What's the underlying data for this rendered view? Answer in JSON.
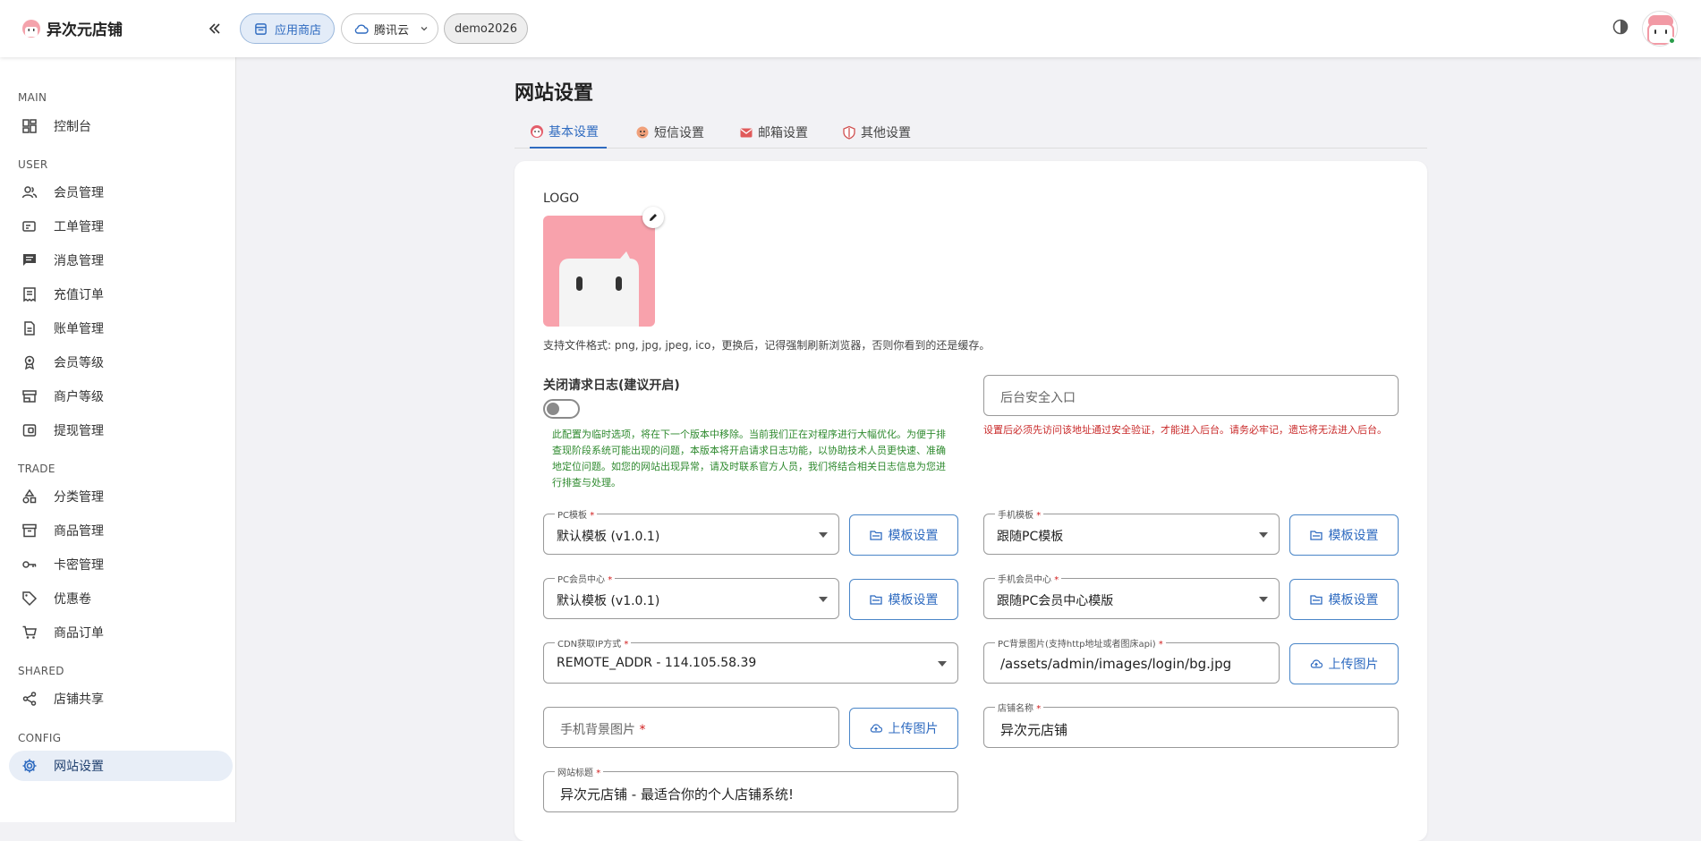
{
  "brand": {
    "name": "异次元店铺"
  },
  "topbar": {
    "store_label": "应用商店",
    "cloud_label": "腾讯云",
    "demo_label": "demo2026"
  },
  "sidebar": {
    "sections": {
      "main": "MAIN",
      "user": "USER",
      "trade": "TRADE",
      "shared": "SHARED",
      "config": "CONFIG"
    },
    "items": [
      {
        "label": "控制台",
        "icon": "dashboard-icon"
      },
      {
        "label": "会员管理",
        "icon": "users-icon"
      },
      {
        "label": "工单管理",
        "icon": "ticket-icon"
      },
      {
        "label": "消息管理",
        "icon": "message-icon"
      },
      {
        "label": "充值订单",
        "icon": "receipt-icon"
      },
      {
        "label": "账单管理",
        "icon": "document-icon"
      },
      {
        "label": "会员等级",
        "icon": "badge-icon"
      },
      {
        "label": "商户等级",
        "icon": "store-icon"
      },
      {
        "label": "提现管理",
        "icon": "wallet-icon"
      },
      {
        "label": "分类管理",
        "icon": "category-icon"
      },
      {
        "label": "商品管理",
        "icon": "archive-icon"
      },
      {
        "label": "卡密管理",
        "icon": "key-icon"
      },
      {
        "label": "优惠卷",
        "icon": "tag-icon"
      },
      {
        "label": "商品订单",
        "icon": "cart-icon"
      },
      {
        "label": "店铺共享",
        "icon": "share-icon"
      },
      {
        "label": "网站设置",
        "icon": "gear-icon",
        "active": true
      }
    ]
  },
  "page": {
    "title": "网站设置",
    "tabs": [
      "基本设置",
      "短信设置",
      "邮箱设置",
      "其他设置"
    ],
    "active_tab": "基本设置"
  },
  "form": {
    "logo_label": "LOGO",
    "logo_hint": "支持文件格式: png, jpg, jpeg, ico，更换后，记得强制刷新浏览器，否则你看到的还是缓存。",
    "request_log_label": "关闭请求日志(建议开启)",
    "request_log_enabled": false,
    "request_log_note": "此配置为临时选项，将在下一个版本中移除。当前我们正在对程序进行大幅优化。为便于排查现阶段系统可能出现的问题，本版本将开启请求日志功能，以协助技术人员更快速、准确地定位问题。如您的网站出现异常，请及时联系官方人员，我们将结合相关日志信息为您进行排查与处理。",
    "admin_entry_placeholder": "后台安全入口",
    "admin_entry_note": "设置后必须先访问该地址通过安全验证，才能进入后台。请务必牢记，遗忘将无法进入后台。",
    "pc_template": {
      "label": "PC模板",
      "value": "默认模板 (v1.0.1)"
    },
    "mobile_template": {
      "label": "手机模板",
      "value": "跟随PC模板"
    },
    "pc_member": {
      "label": "PC会员中心",
      "value": "默认模板 (v1.0.1)"
    },
    "mobile_member": {
      "label": "手机会员中心",
      "value": "跟随PC会员中心模版"
    },
    "cdn_ip": {
      "label": "CDN获取IP方式",
      "value": "REMOTE_ADDR - 114.105.58.39"
    },
    "pc_bg": {
      "label": "PC背景图片(支持http地址或者图床api)",
      "value": "/assets/admin/images/login/bg.jpg"
    },
    "mobile_bg": {
      "placeholder": "手机背景图片"
    },
    "shop_name": {
      "label": "店铺名称",
      "value": "异次元店铺"
    },
    "site_title": {
      "label": "网站标题",
      "value": "异次元店铺 - 最适合你的个人店铺系统!"
    },
    "required_mark": "*",
    "template_btn": "模板设置",
    "upload_btn": "上传图片"
  },
  "colors": {
    "accent": "#2f6bc0",
    "required": "#d01b1b",
    "note_green": "#2f8a2f",
    "note_red": "#c92a2a"
  }
}
